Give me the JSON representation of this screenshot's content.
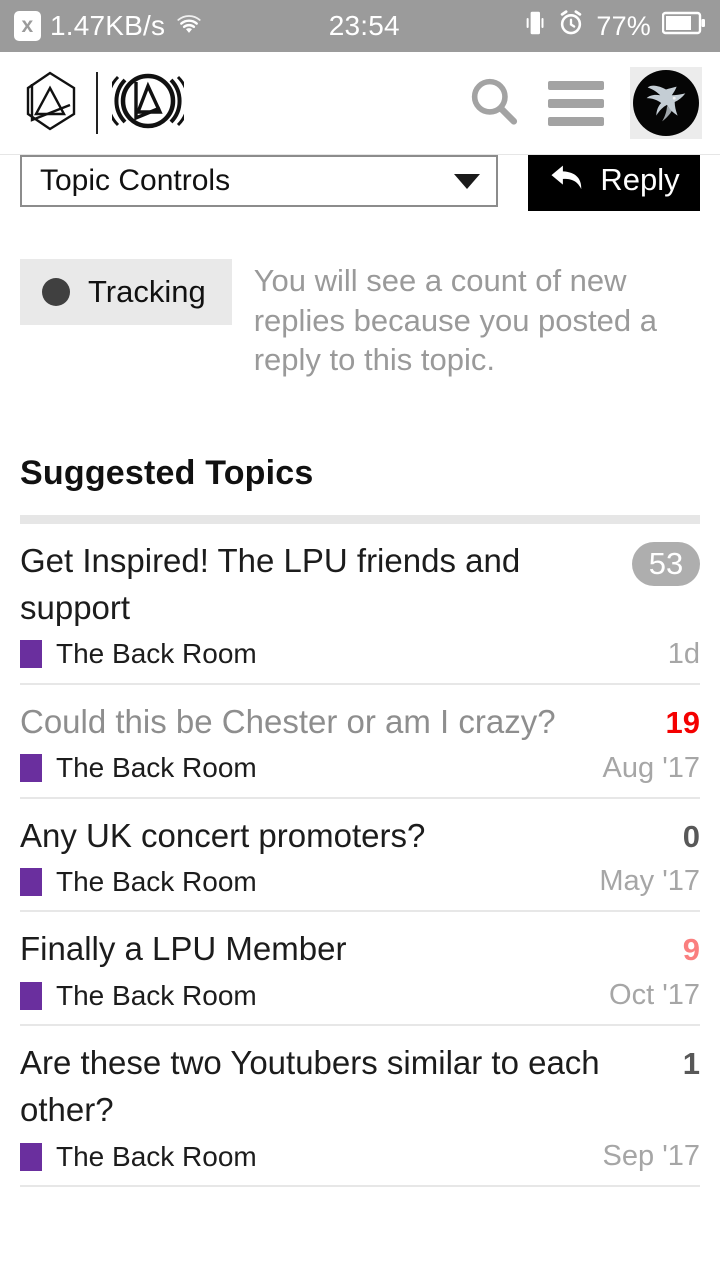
{
  "statusbar": {
    "download_badge": "x",
    "speed": "1.47KB/s",
    "wifi_icon": "wifi-icon",
    "time": "23:54",
    "vibrate_icon": "vibrate-icon",
    "alarm_icon": "alarm-clock-icon",
    "battery_percent": "77%",
    "battery_icon": "battery-icon"
  },
  "header": {
    "logo_primary": "linkin-park-hex-logo",
    "logo_secondary": "linkin-park-circle-logo",
    "search_icon": "search-icon",
    "menu_icon": "hamburger-menu-icon",
    "avatar_icon": "user-avatar-bird"
  },
  "topic_controls": {
    "label": "Topic Controls",
    "caret_icon": "chevron-down-icon"
  },
  "reply_button": {
    "label": "Reply",
    "icon": "reply-arrow-icon"
  },
  "notification": {
    "state_label": "Tracking",
    "state_icon": "filled-circle-icon",
    "description": "You will see a count of new replies because you posted a reply to this topic."
  },
  "suggested": {
    "heading": "Suggested Topics",
    "topics": [
      {
        "title": "Get Inspired! The LPU friends and support",
        "count": "53",
        "count_style": "pill",
        "category": "The Back Room",
        "category_color": "#6a2f9e",
        "age": "1d",
        "visited": false
      },
      {
        "title": "Could this be Chester or am I crazy?",
        "count": "19",
        "count_style": "hot",
        "category": "The Back Room",
        "category_color": "#6a2f9e",
        "age": "Aug '17",
        "visited": true
      },
      {
        "title": "Any UK concert promoters?",
        "count": "0",
        "count_style": "plain",
        "category": "The Back Room",
        "category_color": "#6a2f9e",
        "age": "May '17",
        "visited": false
      },
      {
        "title": "Finally a LPU Member",
        "count": "9",
        "count_style": "warm",
        "category": "The Back Room",
        "category_color": "#6a2f9e",
        "age": "Oct '17",
        "visited": false
      },
      {
        "title": "Are these two Youtubers similar to each other?",
        "count": "1",
        "count_style": "plain",
        "category": "The Back Room",
        "category_color": "#6a2f9e",
        "age": "Sep '17",
        "visited": false
      }
    ]
  },
  "colors": {
    "statusbar_bg": "#9b9b9b",
    "accent_black": "#000000",
    "category_purple": "#6a2f9e",
    "count_hot": "#f40000",
    "count_warm": "#fa7f7f",
    "count_pill": "#aeaeae"
  }
}
